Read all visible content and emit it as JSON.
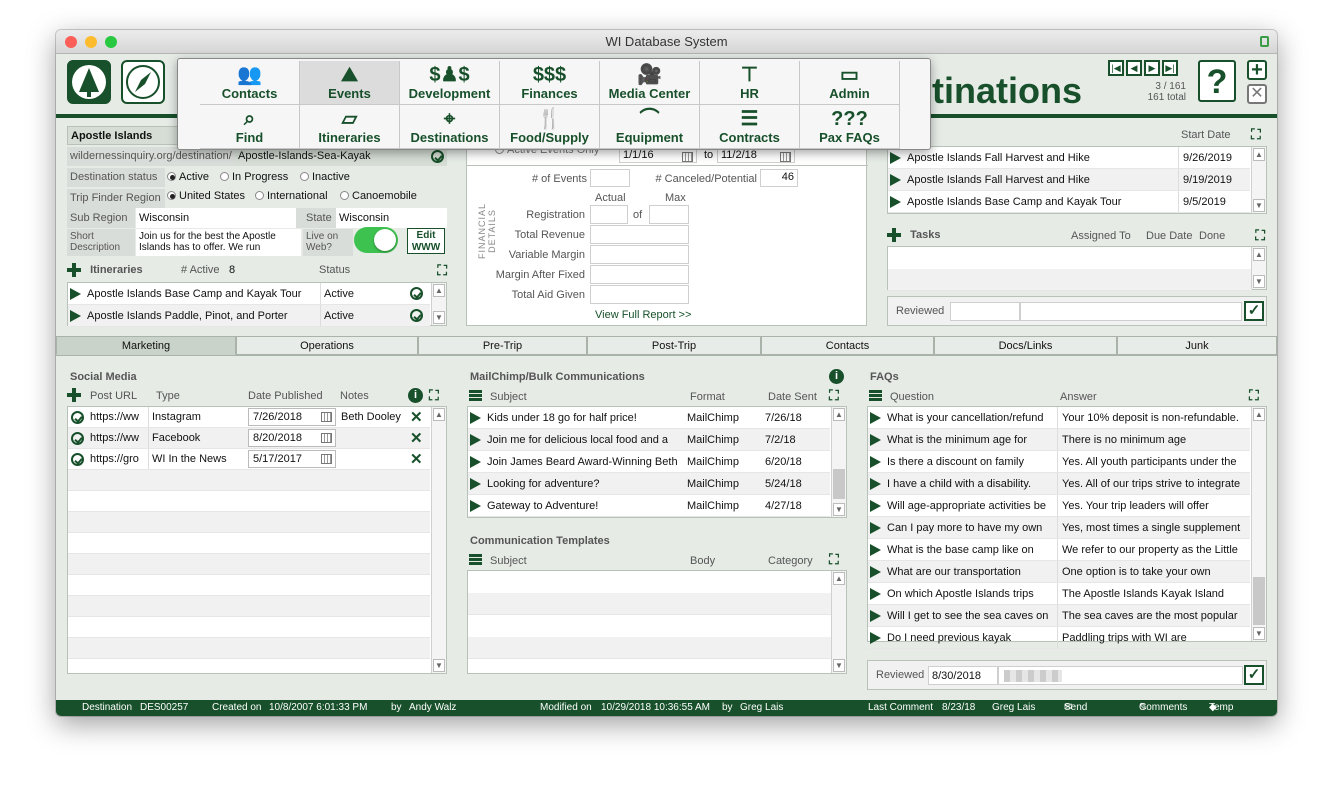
{
  "window": {
    "title": "WI Database System"
  },
  "menu": {
    "row1": [
      {
        "label": "Contacts",
        "icon": "people-icon"
      },
      {
        "label": "Events",
        "icon": "mountains-icon"
      },
      {
        "label": "Development",
        "icon": "donors-icon"
      },
      {
        "label": "Finances",
        "icon": "dollar-icon"
      },
      {
        "label": "Media Center",
        "icon": "camera-icon"
      },
      {
        "label": "HR",
        "icon": "desk-icon"
      },
      {
        "label": "Admin",
        "icon": "toolbox-icon"
      }
    ],
    "row2": [
      {
        "label": "Find",
        "icon": "find-icon"
      },
      {
        "label": "Itineraries",
        "icon": "map-icon"
      },
      {
        "label": "Destinations",
        "icon": "pin-map-icon"
      },
      {
        "label": "Food/Supply",
        "icon": "food-icon"
      },
      {
        "label": "Equipment",
        "icon": "canoe-icon"
      },
      {
        "label": "Contracts",
        "icon": "contract-icon"
      },
      {
        "label": "Pax FAQs",
        "icon": "faq-icon"
      }
    ]
  },
  "header": {
    "title_visible": "tinations",
    "record_pos": "3 / 161",
    "record_total": "161 total",
    "help": "?"
  },
  "destination": {
    "name": "Apostle Islands",
    "url_prefix": "wildernessinquiry.org/destination/",
    "url_slug": "Apostle-Islands-Sea-Kayak",
    "status_label": "Destination status",
    "status_options": [
      "Active",
      "In Progress",
      "Inactive"
    ],
    "region_label": "Trip Finder Region",
    "region_options": [
      "United States",
      "International",
      "Canoemobile"
    ],
    "subregion_label": "Sub Region",
    "subregion": "Wisconsin",
    "state_label": "State",
    "state": "Wisconsin",
    "short_desc_label": "Short Description",
    "short_desc": "Join us for the best the Apostle Islands has to offer. We run",
    "live_label": "Live on Web?",
    "edit_www": "Edit WWW"
  },
  "itineraries": {
    "title": "Itineraries",
    "active_label": "# Active",
    "active_count": "8",
    "status_label": "Status",
    "rows": [
      {
        "name": "Apostle Islands Base Camp and Kayak Tour",
        "status": "Active"
      },
      {
        "name": "Apostle Islands Paddle, Pinot, and Porter",
        "status": "Active"
      }
    ]
  },
  "financial": {
    "vertical_label": "FINANCIAL DETAILS",
    "active_only": "Active Events Only",
    "date_from": "1/1/16",
    "to_label": "to",
    "date_to": "11/2/18",
    "events_label": "# of Events",
    "canceled_label": "# Canceled/Potential",
    "canceled_value": "46",
    "actual_label": "Actual",
    "max_label": "Max",
    "of_label": "of",
    "lines": [
      "Registration",
      "Total Revenue",
      "Variable Margin",
      "Margin After Fixed",
      "Total Aid Given"
    ],
    "full_report": "View Full Report >>"
  },
  "events": {
    "start_date_label": "Start Date",
    "rows": [
      {
        "name": "Apostle Islands Fall Harvest and Hike",
        "date": "9/26/2019"
      },
      {
        "name": "Apostle Islands Fall Harvest and Hike",
        "date": "9/19/2019"
      },
      {
        "name": "Apostle Islands Base Camp and Kayak Tour",
        "date": "9/5/2019"
      }
    ]
  },
  "tasks": {
    "title": "Tasks",
    "assigned": "Assigned To",
    "due": "Due Date",
    "done": "Done",
    "reviewed": "Reviewed"
  },
  "tabs": [
    "Marketing",
    "Operations",
    "Pre-Trip",
    "Post-Trip",
    "Contacts",
    "Docs/Links",
    "Junk"
  ],
  "social": {
    "title": "Social Media",
    "cols": [
      "Post URL",
      "Type",
      "Date Published",
      "Notes"
    ],
    "rows": [
      {
        "url": "https://ww",
        "type": "Instagram",
        "date": "7/26/2018",
        "notes": "Beth Dooley"
      },
      {
        "url": "https://ww",
        "type": "Facebook",
        "date": "8/20/2018",
        "notes": ""
      },
      {
        "url": "https://gro",
        "type": "WI In the News",
        "date": "5/17/2017",
        "notes": ""
      }
    ]
  },
  "mailchimp": {
    "title": "MailChimp/Bulk Communications",
    "cols": [
      "Subject",
      "Format",
      "Date Sent"
    ],
    "rows": [
      {
        "subject": "Kids under 18 go for half price!",
        "format": "MailChimp",
        "date": "7/26/18"
      },
      {
        "subject": "Join me for delicious local food and a",
        "format": "MailChimp",
        "date": "7/2/18"
      },
      {
        "subject": "Join James Beard Award-Winning Beth",
        "format": "MailChimp",
        "date": "6/20/18"
      },
      {
        "subject": "Looking for adventure?",
        "format": "MailChimp",
        "date": "5/24/18"
      },
      {
        "subject": "Gateway to Adventure!",
        "format": "MailChimp",
        "date": "4/27/18"
      }
    ]
  },
  "templates": {
    "title": "Communication Templates",
    "cols": [
      "Subject",
      "Body",
      "Category"
    ]
  },
  "faqs": {
    "title": "FAQs",
    "cols": [
      "Question",
      "Answer"
    ],
    "rows": [
      {
        "q": "What is your cancellation/refund",
        "a": "Your 10% deposit is non-refundable."
      },
      {
        "q": "What is the minimum age for",
        "a": "There is no minimum age"
      },
      {
        "q": "Is there a discount on family",
        "a": "Yes. All youth participants under the"
      },
      {
        "q": "I have a child with a disability.",
        "a": "Yes. All of our trips strive to integrate"
      },
      {
        "q": "Will age-appropriate activities be",
        "a": "Yes. Your trip leaders will offer"
      },
      {
        "q": "Can I pay more to have my own",
        "a": "Yes, most times a single supplement"
      },
      {
        "q": "What is the base camp like on",
        "a": "We refer to our property as the Little"
      },
      {
        "q": "What are our transportation",
        "a": "One option is to take your own"
      },
      {
        "q": "On which Apostle Islands trips",
        "a": "The Apostle Islands Kayak Island"
      },
      {
        "q": "Will I get to see the sea caves on",
        "a": "The sea caves are the most popular"
      },
      {
        "q": "Do I need previous kayak",
        "a": "Paddling trips with WI are"
      }
    ],
    "reviewed_label": "Reviewed",
    "reviewed_date": "8/30/2018"
  },
  "statusbar": {
    "dest_label": "Destination",
    "dest_id": "DES00257",
    "created_label": "Created on",
    "created": "10/8/2007 6:01:33 PM",
    "by_label": "by",
    "created_by": "Andy Walz",
    "modified_label": "Modified on",
    "modified": "10/29/2018 10:36:55 AM",
    "modified_by": "Greg Lais",
    "last_comment_label": "Last Comment",
    "last_comment": "8/23/18",
    "last_comment_by": "Greg Lais",
    "send_link": "Send Link",
    "comments": "Comments",
    "temp_tags": "Temp Tags"
  },
  "colors": {
    "brand": "#17502a",
    "panel": "#e6ebe6"
  }
}
